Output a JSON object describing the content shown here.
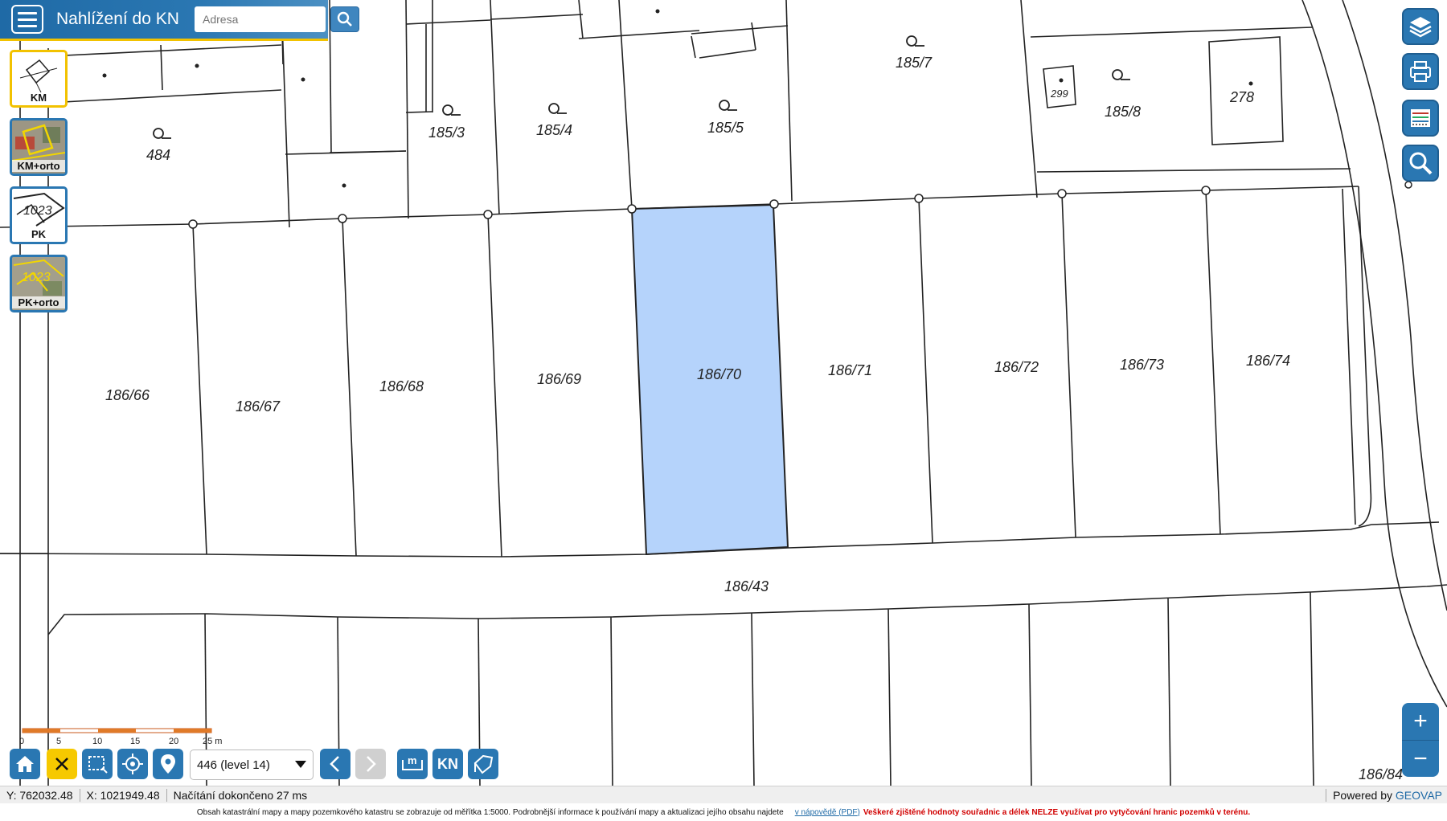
{
  "header": {
    "title": "Nahlížení do KN",
    "search_placeholder": "Adresa"
  },
  "layers": [
    {
      "label": "KM",
      "active": true
    },
    {
      "label": "KM+orto",
      "active": false
    },
    {
      "label": "PK",
      "active": false,
      "thumb_text": "1023"
    },
    {
      "label": "PK+orto",
      "active": false,
      "thumb_text": "1023"
    }
  ],
  "map": {
    "parcels": [
      "484",
      "185/3",
      "185/4",
      "185/5",
      "185/7",
      "185/8",
      "278",
      "299",
      "186/66",
      "186/67",
      "186/68",
      "186/69",
      "186/70",
      "186/71",
      "186/72",
      "186/73",
      "186/74",
      "186/43",
      "186/84"
    ],
    "selected_parcel": "186/70",
    "selected_color": "#b5d3fb"
  },
  "scale_bar": {
    "ticks": [
      "0",
      "5",
      "10",
      "15",
      "20",
      "25 m"
    ]
  },
  "toolbar": {
    "level_value": "446 (level 14)",
    "kn_label": "KN"
  },
  "status": {
    "y": "Y: 762032.48",
    "x": "X: 1021949.48",
    "loading": "Načítání dokončeno 27 ms",
    "powered_prefix": "Powered by",
    "powered_brand": "GEOVAP"
  },
  "footer": {
    "info": "Obsah katastrální mapy a mapy pozemkového katastru se zobrazuje od měřítka 1:5000. Podrobnější informace k používání mapy a aktualizaci jejího obsahu najdete",
    "link": "v nápovědě (PDF)",
    "warning": "Veškeré zjištěné hodnoty souřadnic a délek NELZE využívat pro vytyčování hranic pozemků v terénu."
  }
}
